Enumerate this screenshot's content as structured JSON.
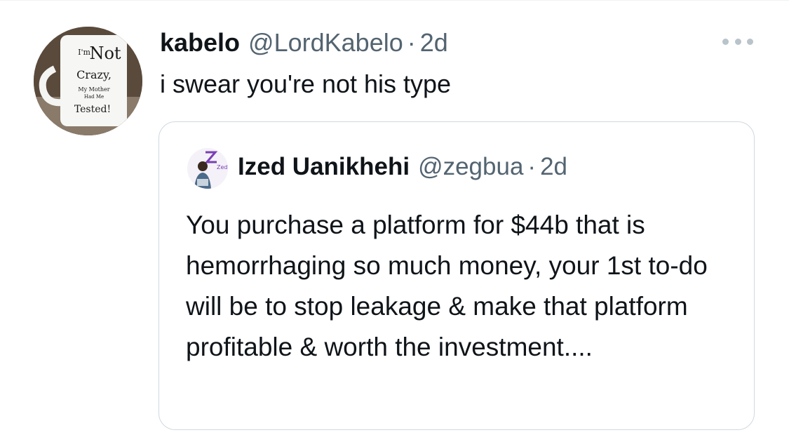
{
  "tweet": {
    "author_name": "kabelo",
    "author_handle": "@LordKabelo",
    "separator": "·",
    "time": "2d",
    "text": "i swear you're not his type",
    "avatar_mug_text": [
      "I'm",
      "Not",
      "Crazy,",
      "My Mother",
      "Had Me",
      "Tested!"
    ]
  },
  "quoted_tweet": {
    "author_name": "Ized Uanikhehi",
    "author_handle": "@zegbua",
    "separator": "·",
    "time": "2d",
    "text": "You purchase a platform for $44b that is hemorrhaging so much money, your 1st to-do will be to stop leakage & make that platform profitable & worth the investment....",
    "avatar_logo_text": "Zedi"
  },
  "icons": {
    "more": "more-horizontal-icon"
  },
  "colors": {
    "text_primary": "#0f1419",
    "text_secondary": "#536471",
    "border": "#cfd9de",
    "more_dots": "#b9c3ca",
    "logo_purple": "#7a3fb5"
  }
}
